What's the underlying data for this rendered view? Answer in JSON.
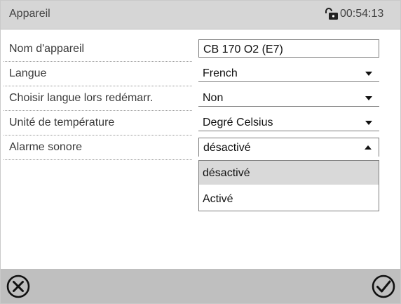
{
  "header": {
    "title": "Appareil",
    "time": "00:54:13",
    "lock_icon": "lock-icon"
  },
  "rows": [
    {
      "label": "Nom d'appareil",
      "value": "CB 170 O2 (E7)",
      "type": "text"
    },
    {
      "label": "Langue",
      "value": "French",
      "type": "dropdown"
    },
    {
      "label": "Choisir langue lors redémarr.",
      "value": "Non",
      "type": "dropdown"
    },
    {
      "label": "Unité de température",
      "value": "Degré Celsius",
      "type": "dropdown"
    },
    {
      "label": "Alarme sonore",
      "value": "désactivé",
      "type": "dropdown-open"
    }
  ],
  "menu": {
    "options": [
      "désactivé",
      "Activé"
    ],
    "selected_index": 0
  },
  "footer": {
    "cancel_icon": "cancel-icon",
    "confirm_icon": "check-icon"
  },
  "colors": {
    "header_bg": "#d6d6d6",
    "footer_bg": "#bfbfbf",
    "selected_option_bg": "#d9d9d9"
  }
}
